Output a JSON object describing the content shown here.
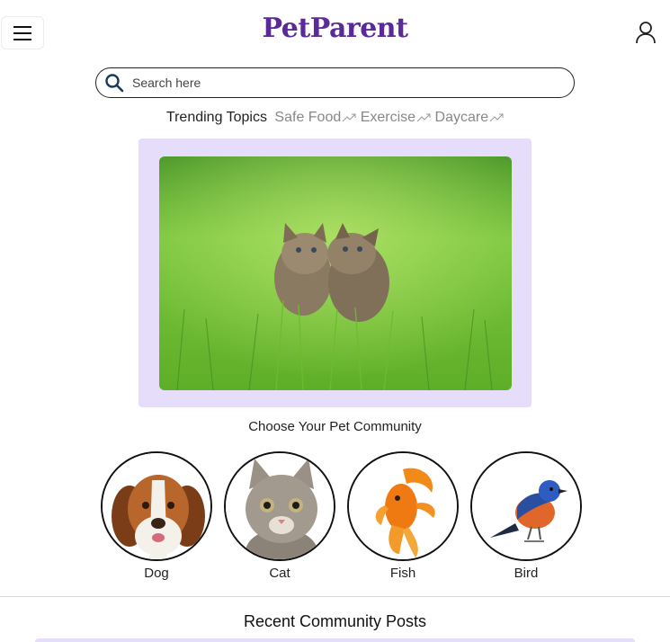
{
  "header": {
    "menu_icon": "hamburger-menu-icon",
    "logo_text": "PetParent",
    "profile_icon": "user-profile-icon",
    "brand_color": "#5b2a96"
  },
  "search": {
    "placeholder": "Search here",
    "icon": "search-icon"
  },
  "trending": {
    "label": "Trending Topics",
    "topics": [
      {
        "label": "Safe Food"
      },
      {
        "label": "Exercise"
      },
      {
        "label": "Daycare"
      }
    ],
    "topic_icon": "trending-up-icon"
  },
  "hero": {
    "image": "two-kittens-in-grass-photo",
    "frame_color": "#e6ddfa"
  },
  "community": {
    "title": "Choose Your Pet Community",
    "pets": [
      {
        "label": "Dog",
        "image": "dog-photo"
      },
      {
        "label": "Cat",
        "image": "cat-photo"
      },
      {
        "label": "Fish",
        "image": "goldfish-photo"
      },
      {
        "label": "Bird",
        "image": "bird-photo"
      }
    ]
  },
  "recent": {
    "title": "Recent Community Posts"
  }
}
